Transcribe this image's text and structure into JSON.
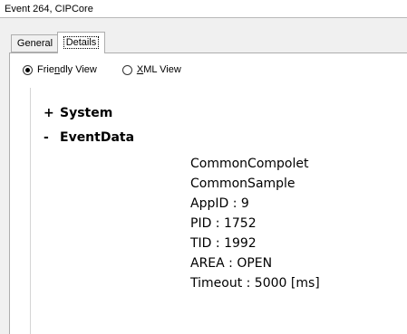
{
  "window": {
    "title": "Event 264, CIPCore"
  },
  "tabs": [
    {
      "label": "General",
      "selected": false
    },
    {
      "label": "Details",
      "selected": true
    }
  ],
  "view_options": {
    "friendly": {
      "label_before": "Frie",
      "label_underlined": "n",
      "label_after": "dly View",
      "selected": true
    },
    "xml": {
      "label_before": "",
      "label_underlined": "X",
      "label_after": "ML View",
      "selected": false
    }
  },
  "tree": {
    "system": {
      "marker": "+",
      "label": "System"
    },
    "eventdata": {
      "marker": "-",
      "label": "EventData"
    },
    "eventdata_lines": [
      "CommonCompolet",
      "CommonSample",
      "AppID : 9",
      "PID : 1752",
      "TID : 1992",
      "AREA : OPEN",
      "Timeout : 5000 [ms]"
    ]
  },
  "colors": {
    "border": "#adadad",
    "panel_bg": "#ffffff",
    "chrome_bg": "#f0f0f0"
  }
}
